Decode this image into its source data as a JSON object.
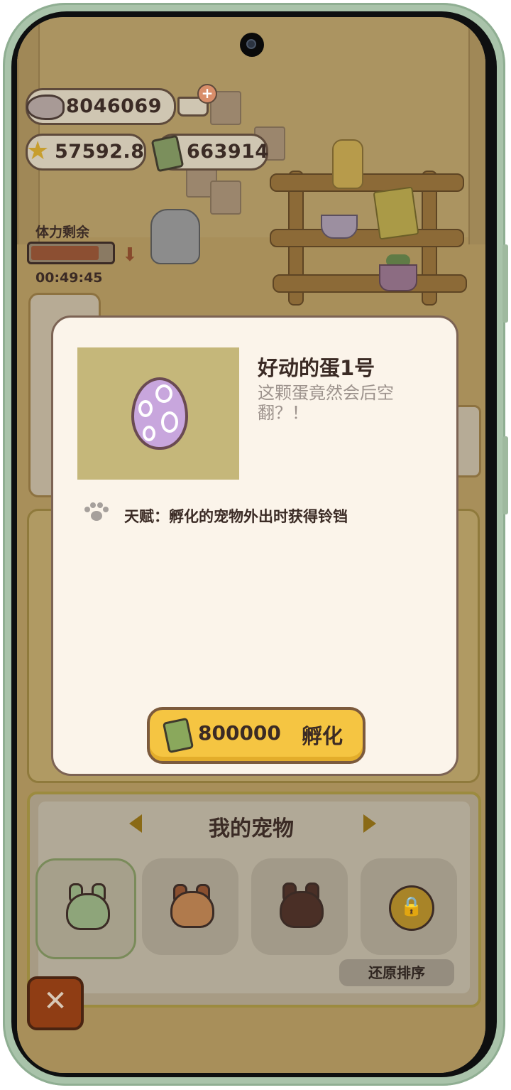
{
  "resources": {
    "fish_coins": "8046069",
    "stars": "57592.8",
    "tickets": "663914"
  },
  "stamina": {
    "label": "体力剩余",
    "timer": "00:49:45",
    "level": 0.85
  },
  "dialog": {
    "pet_name": "好动的蛋1号",
    "description": "这颗蛋竟然会后空翻？！",
    "talent": "天赋：孵化的宠物外出时获得铃铛",
    "hatch_price": "800000",
    "hatch_label": "孵化"
  },
  "pets": {
    "title": "我的宠物",
    "restore_label": "还原排序",
    "slots": [
      {
        "icon": "green-bunny-pet-icon",
        "selected": true
      },
      {
        "icon": "orange-cat-pet-icon",
        "selected": false
      },
      {
        "icon": "dark-blob-pet-icon",
        "selected": false
      },
      {
        "icon": "lock-icon",
        "selected": false
      }
    ]
  },
  "close_label": "✕"
}
